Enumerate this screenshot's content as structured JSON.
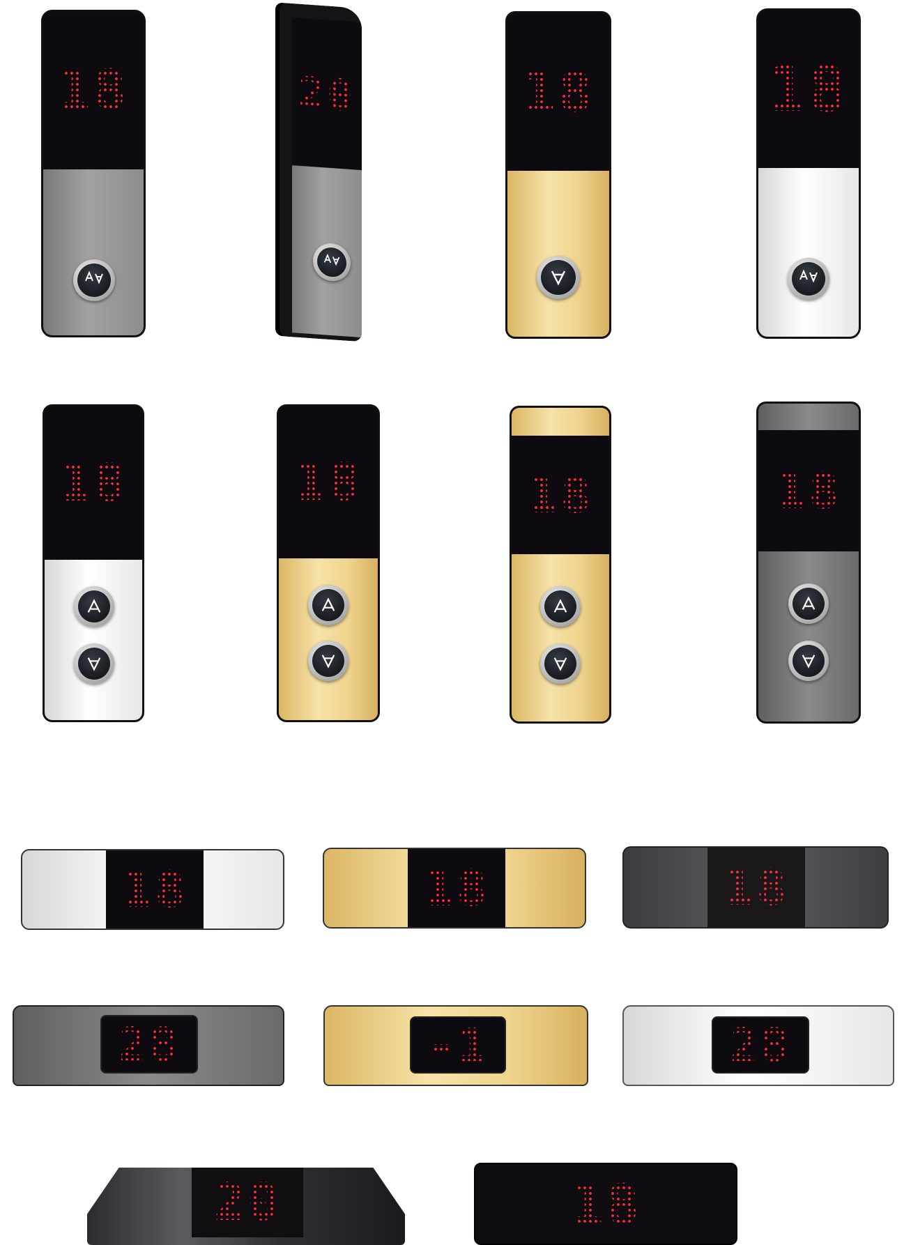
{
  "vertical_panels": [
    {
      "floor": "18",
      "finish": "steel",
      "buttons": [
        "up-down"
      ]
    },
    {
      "floor": "20",
      "finish": "steel",
      "buttons": [
        "up-down"
      ]
    },
    {
      "floor": "18",
      "finish": "gold",
      "buttons": [
        "down"
      ]
    },
    {
      "floor": "18",
      "finish": "mirror",
      "buttons": [
        "up-down"
      ]
    },
    {
      "floor": "18",
      "finish": "mirror",
      "buttons": [
        "up",
        "down"
      ]
    },
    {
      "floor": "18",
      "finish": "gold",
      "buttons": [
        "up",
        "down"
      ]
    },
    {
      "floor": "18",
      "finish": "gold",
      "buttons": [
        "up",
        "down"
      ]
    },
    {
      "floor": "18",
      "finish": "graphite",
      "buttons": [
        "up",
        "down"
      ]
    }
  ],
  "horizontal_indicators": [
    {
      "floor": "18",
      "finish": "mirror"
    },
    {
      "floor": "18",
      "finish": "gold"
    },
    {
      "floor": "18",
      "finish": "dark"
    },
    {
      "floor": "28",
      "finish": "steel"
    },
    {
      "floor": "-1",
      "finish": "gold"
    },
    {
      "floor": "28",
      "finish": "mirror"
    },
    {
      "floor": "20",
      "finish": "black"
    },
    {
      "floor": "18",
      "finish": "black"
    }
  ],
  "colors": {
    "led": "#ff2b3a",
    "screen": "#0d0b10"
  }
}
